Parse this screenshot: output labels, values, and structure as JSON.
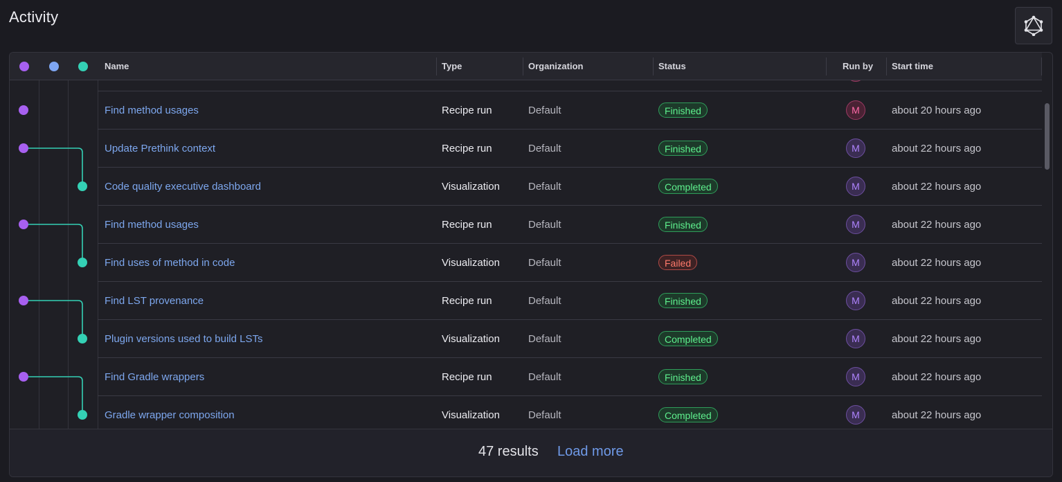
{
  "page": {
    "title": "Activity"
  },
  "graph_button": {
    "icon": "graphql-icon"
  },
  "colors": {
    "lane1": "#a760f0",
    "lane2": "#7ea6f3",
    "lane3": "#34d1b5"
  },
  "columns": {
    "name": "Name",
    "type": "Type",
    "organization": "Organization",
    "status": "Status",
    "run_by": "Run by",
    "start_time": "Start time"
  },
  "rows": [
    {
      "name": "Find method usages",
      "type": "Recipe run",
      "organization": "Default",
      "status": "Finished",
      "run_by": "M",
      "start_time": "about 20 hours ago"
    },
    {
      "name": "Update Prethink context",
      "type": "Recipe run",
      "organization": "Default",
      "status": "Finished",
      "run_by": "M",
      "start_time": "about 22 hours ago"
    },
    {
      "name": "Code quality executive dashboard",
      "type": "Visualization",
      "organization": "Default",
      "status": "Completed",
      "run_by": "M",
      "start_time": "about 22 hours ago"
    },
    {
      "name": "Find method usages",
      "type": "Recipe run",
      "organization": "Default",
      "status": "Finished",
      "run_by": "M",
      "start_time": "about 22 hours ago"
    },
    {
      "name": "Find uses of method in code",
      "type": "Visualization",
      "organization": "Default",
      "status": "Failed",
      "run_by": "M",
      "start_time": "about 22 hours ago"
    },
    {
      "name": "Find LST provenance",
      "type": "Recipe run",
      "organization": "Default",
      "status": "Finished",
      "run_by": "M",
      "start_time": "about 22 hours ago"
    },
    {
      "name": "Plugin versions used to build LSTs",
      "type": "Visualization",
      "organization": "Default",
      "status": "Completed",
      "run_by": "M",
      "start_time": "about 22 hours ago"
    },
    {
      "name": "Find Gradle wrappers",
      "type": "Recipe run",
      "organization": "Default",
      "status": "Finished",
      "run_by": "M",
      "start_time": "about 22 hours ago"
    },
    {
      "name": "Gradle wrapper composition",
      "type": "Visualization",
      "organization": "Default",
      "status": "Completed",
      "run_by": "M",
      "start_time": "about 22 hours ago"
    }
  ],
  "footer": {
    "results": "47 results",
    "load_more": "Load more"
  }
}
